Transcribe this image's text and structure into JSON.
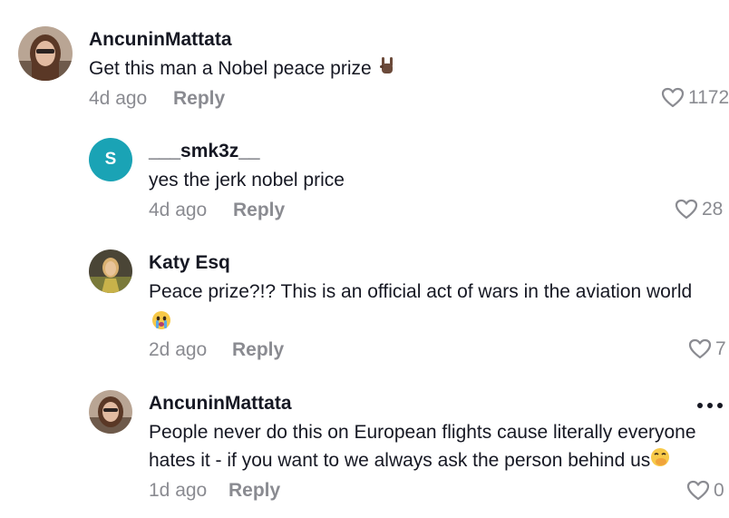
{
  "comments": [
    {
      "username": "AncuninMattata",
      "text": "Get this man a Nobel peace prize",
      "emoji": "rock-on-hand",
      "time": "4d ago",
      "reply_label": "Reply",
      "likes": "1172"
    },
    {
      "avatar_letter": "S",
      "username": "___smk3z__",
      "text": "yes the jerk nobel price",
      "time": "4d ago",
      "reply_label": "Reply",
      "likes": "28"
    },
    {
      "username": "Katy Esq",
      "text": "Peace prize?!? This is an official act of wars in the aviation world",
      "emoji": "crying-face",
      "time": "2d ago",
      "reply_label": "Reply",
      "likes": "7"
    },
    {
      "username": "AncuninMattata",
      "text_line1": "People never do this on European flights cause literally everyone",
      "text_line2": "hates it - if you want to we always ask the person behind us",
      "emoji": "face-with-hand-over-mouth",
      "time": "1d ago",
      "reply_label": "Reply",
      "likes": "0"
    }
  ],
  "colors": {
    "text": "#161823",
    "meta": "#8a8b91",
    "letter_avatar": "#1aa3b5"
  }
}
